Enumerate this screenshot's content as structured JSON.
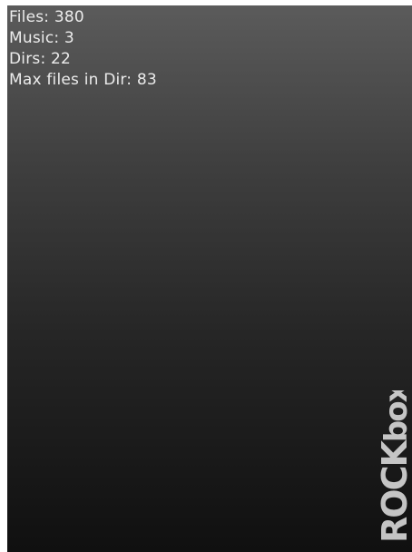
{
  "stats": {
    "files": "Files: 380",
    "music": "Music: 3",
    "dirs": "Dirs: 22",
    "max_files": "Max files in Dir: 83"
  },
  "logo": {
    "text_upper": "ROCK",
    "text_lower": "box"
  }
}
